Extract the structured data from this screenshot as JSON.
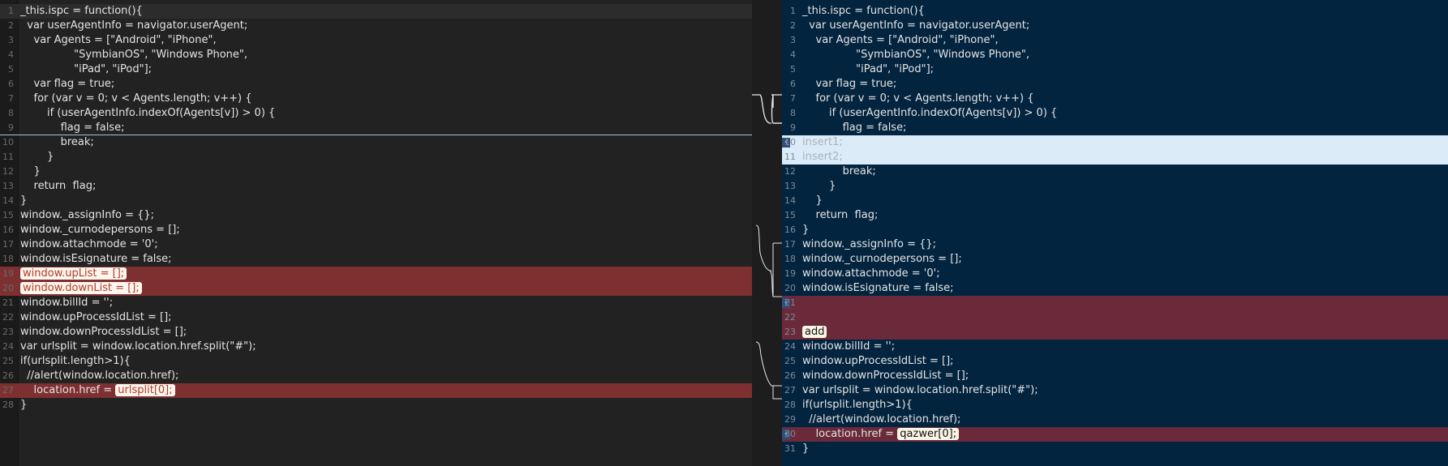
{
  "left": {
    "lines": [
      {
        "n": "1",
        "t": "_this.ispc = function(){"
      },
      {
        "n": "2",
        "t": "  var userAgentInfo = navigator.userAgent;"
      },
      {
        "n": "3",
        "t": "    var Agents = [\"Android\", \"iPhone\","
      },
      {
        "n": "4",
        "t": "                \"SymbianOS\", \"Windows Phone\","
      },
      {
        "n": "5",
        "t": "                \"iPad\", \"iPod\"];"
      },
      {
        "n": "6",
        "t": "    var flag = true;"
      },
      {
        "n": "7",
        "t": "    for (var v = 0; v < Agents.length; v++) {"
      },
      {
        "n": "8",
        "t": "        if (userAgentInfo.indexOf(Agents[v]) > 0) {"
      },
      {
        "n": "9",
        "t": "            flag = false;"
      },
      {
        "n": "10",
        "t": "            break;"
      },
      {
        "n": "11",
        "t": "        }"
      },
      {
        "n": "12",
        "t": "    }"
      },
      {
        "n": "13",
        "t": "    return  flag;"
      },
      {
        "n": "14",
        "t": "}"
      },
      {
        "n": "15",
        "t": "window._assignInfo = {};"
      },
      {
        "n": "16",
        "t": "window._curnodepersons = [];"
      },
      {
        "n": "17",
        "t": "window.attachmode = '0';"
      },
      {
        "n": "18",
        "t": "window.isEsignature = false;"
      },
      {
        "n": "19",
        "t": "",
        "m": "window.upList = [];"
      },
      {
        "n": "20",
        "t": "",
        "m": "window.downList = [];"
      },
      {
        "n": "21",
        "t": "window.billId = '';"
      },
      {
        "n": "22",
        "t": "window.upProcessIdList = [];"
      },
      {
        "n": "23",
        "t": "window.downProcessIdList = [];"
      },
      {
        "n": "24",
        "t": "var urlsplit = window.location.href.split(\"#\");"
      },
      {
        "n": "25",
        "t": "if(urlsplit.length>1){"
      },
      {
        "n": "26",
        "t": "  //alert(window.location.href);"
      },
      {
        "n": "27",
        "t": "    location.href = ",
        "m": "urlsplit[0];"
      },
      {
        "n": "28",
        "t": "}"
      }
    ]
  },
  "right": {
    "lines": [
      {
        "n": "1",
        "t": "_this.ispc = function(){"
      },
      {
        "n": "2",
        "t": "  var userAgentInfo = navigator.userAgent;"
      },
      {
        "n": "3",
        "t": "    var Agents = [\"Android\", \"iPhone\","
      },
      {
        "n": "4",
        "t": "                \"SymbianOS\", \"Windows Phone\","
      },
      {
        "n": "5",
        "t": "                \"iPad\", \"iPod\"];"
      },
      {
        "n": "6",
        "t": "    var flag = true;"
      },
      {
        "n": "7",
        "t": "    for (var v = 0; v < Agents.length; v++) {"
      },
      {
        "n": "8",
        "t": "        if (userAgentInfo.indexOf(Agents[v]) > 0) {"
      },
      {
        "n": "9",
        "t": "            flag = false;"
      },
      {
        "n": "10",
        "t": "insert1;"
      },
      {
        "n": "11",
        "t": "insert2;"
      },
      {
        "n": "12",
        "t": "            break;"
      },
      {
        "n": "13",
        "t": "        }"
      },
      {
        "n": "14",
        "t": "    }"
      },
      {
        "n": "15",
        "t": "    return  flag;"
      },
      {
        "n": "16",
        "t": "}"
      },
      {
        "n": "17",
        "t": "window._assignInfo = {};"
      },
      {
        "n": "18",
        "t": "window._curnodepersons = [];"
      },
      {
        "n": "19",
        "t": "window.attachmode = '0';"
      },
      {
        "n": "20",
        "t": "window.isEsignature = false;"
      },
      {
        "n": "21",
        "t": ""
      },
      {
        "n": "22",
        "t": ""
      },
      {
        "n": "23",
        "t": "",
        "m": "add"
      },
      {
        "n": "24",
        "t": "window.billId = '';"
      },
      {
        "n": "25",
        "t": "window.upProcessIdList = [];"
      },
      {
        "n": "26",
        "t": "window.downProcessIdList = [];"
      },
      {
        "n": "27",
        "t": "var urlsplit = window.location.href.split(\"#\");"
      },
      {
        "n": "28",
        "t": "if(urlsplit.length>1){"
      },
      {
        "n": "29",
        "t": "  //alert(window.location.href);"
      },
      {
        "n": "30",
        "t": "    location.href = ",
        "m": "qazwer[0];"
      },
      {
        "n": "31",
        "t": "}"
      }
    ]
  }
}
